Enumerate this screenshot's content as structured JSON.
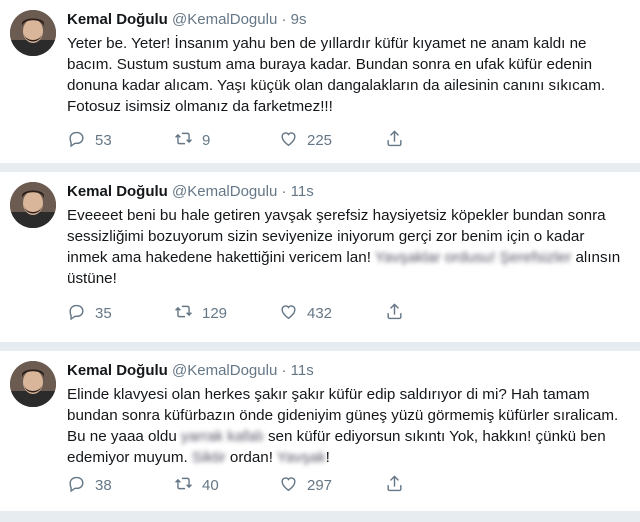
{
  "tweets": [
    {
      "name": "Kemal Doğulu",
      "handle": "@KemalDogulu",
      "dot": "·",
      "time": "9s",
      "text_parts": [
        {
          "t": "Yeter be. Yeter! İnsanım yahu ben de yıllardır küfür kıyamet ne anam kaldı ne bacım. Sustum sustum ama buraya kadar. Bundan sonra en ufak küfür edenin donuna kadar alıcam. Yaşı küçük olan dangalakların da ailesinin canını sıkıcam. Fotosuz isimsiz olmanız da farketmez!!!",
          "blur": false
        }
      ],
      "replies": "53",
      "retweets": "9",
      "likes": "225"
    },
    {
      "name": "Kemal Doğulu",
      "handle": "@KemalDogulu",
      "dot": "·",
      "time": "11s",
      "text_parts": [
        {
          "t": "Eveeeet beni bu hale getiren yavşak şerefsiz haysiyetsiz köpekler bundan sonra sessizliğimi bozuyorum sizin seviyenize iniyorum gerçi zor benim için o kadar inmek ama hakedene hakettiğini vericem lan!",
          "blur": false
        },
        {
          "t": " Yavşaklar ordusu! Şerefsizler ",
          "blur": true
        },
        {
          "t": "alınsın üstüne!",
          "blur": false
        }
      ],
      "replies": "35",
      "retweets": "129",
      "likes": "432"
    },
    {
      "name": "Kemal Doğulu",
      "handle": "@KemalDogulu",
      "dot": "·",
      "time": "11s",
      "text_parts": [
        {
          "t": "Elinde klavyesi olan herkes şakır şakır küfür edip saldırıyor di mi? Hah tamam bundan sonra küfürbazın önde gideniyim güneş yüzü görmemiş küfürler sıralicam. Bu ne yaaa oldu ",
          "blur": false
        },
        {
          "t": "yarrak kafalı",
          "blur": true
        },
        {
          "t": " sen küfür ediyorsun sıkıntı Yok, hakkın! çünkü ben edemiyor muyum. ",
          "blur": false
        },
        {
          "t": "Siktir",
          "blur": true
        },
        {
          "t": " ordan! ",
          "blur": false
        },
        {
          "t": "Yavşak",
          "blur": true
        },
        {
          "t": "!",
          "blur": false
        }
      ],
      "replies": "38",
      "retweets": "40",
      "likes": "297"
    }
  ],
  "icons": {
    "reply": "reply-icon",
    "retweet": "retweet-icon",
    "like": "heart-icon",
    "share": "share-icon"
  },
  "colors": {
    "text": "#14171a",
    "secondary": "#657786",
    "background": "#e6ecf0"
  }
}
